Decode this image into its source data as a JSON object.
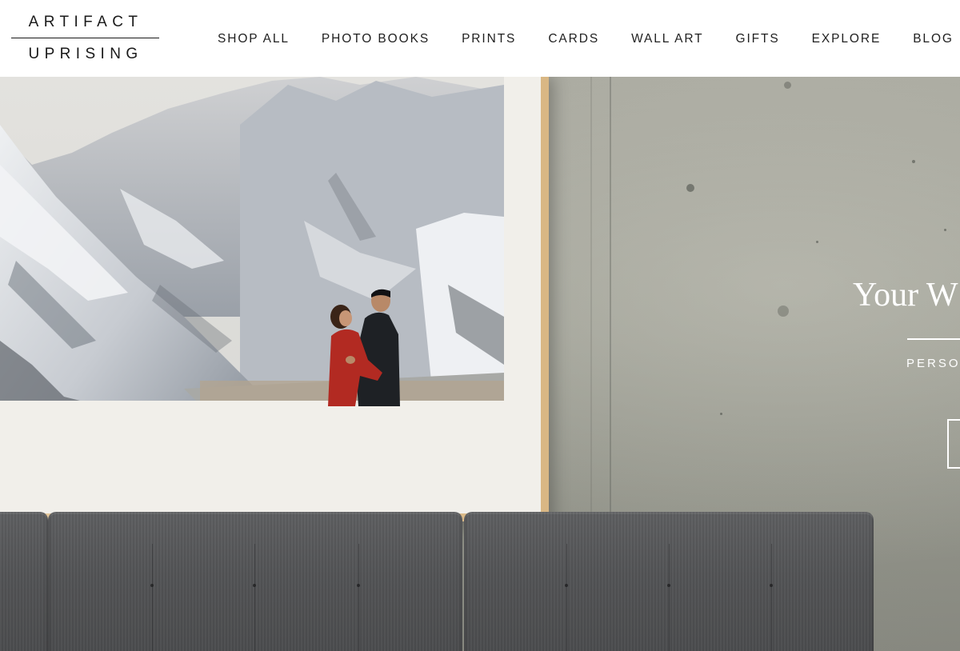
{
  "brand": {
    "line1": "ARTIFACT",
    "line2": "UPRISING"
  },
  "nav": {
    "items": [
      {
        "label": "SHOP ALL"
      },
      {
        "label": "PHOTO BOOKS"
      },
      {
        "label": "PRINTS"
      },
      {
        "label": "CARDS"
      },
      {
        "label": "WALL ART"
      },
      {
        "label": "GIFTS"
      },
      {
        "label": "EXPLORE"
      },
      {
        "label": "BLOG"
      }
    ]
  },
  "hero": {
    "headline": "Your W",
    "subheadline": "PERSO",
    "cta_label": ""
  },
  "colors": {
    "brand_text": "#1a1a1a",
    "frame_wood": "#e0c08f",
    "concrete": "#9c9d93",
    "sofa": "#525355"
  }
}
